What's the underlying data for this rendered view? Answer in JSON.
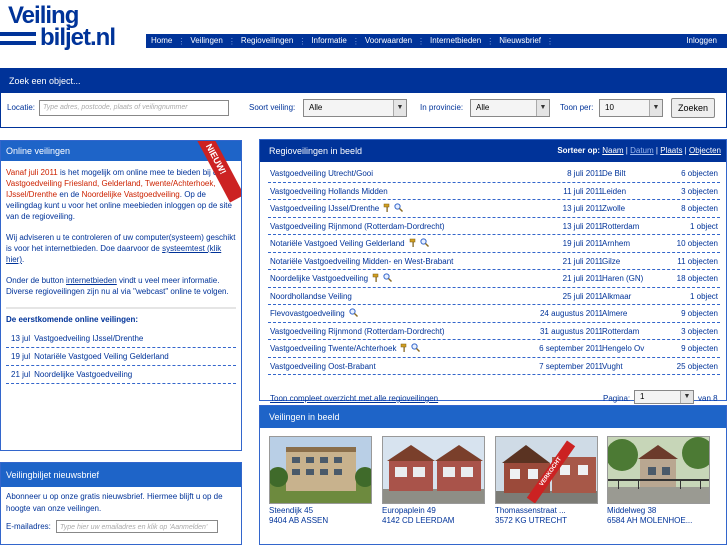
{
  "brand": {
    "line1": "Veiling",
    "line2": "biljet.nl"
  },
  "nav": {
    "items": [
      "Home",
      "Veilingen",
      "Regioveilingen",
      "Informatie",
      "Voorwaarden",
      "Internetbieden",
      "Nieuwsbrief"
    ],
    "login": "Inloggen"
  },
  "search": {
    "title": "Zoek een object...",
    "location_label": "Locatie:",
    "location_placeholder": "Type adres, postcode, plaats of veilingnummer",
    "type_label": "Soort veiling:",
    "type_value": "Alle",
    "province_label": "In provincie:",
    "province_value": "Alle",
    "show_label": "Toon per:",
    "show_value": "10",
    "button": "Zoeken"
  },
  "online": {
    "title": "Online veilingen",
    "ribbon": "NIEUW!",
    "p1_date": "Vanaf juli 2011",
    "p1_a": " is het mogelijk om online mee te bieden bij de ",
    "p1_b": "Vastgoedveiling Friesland, Gelderland, Twente/Achterhoek, IJssel/Drenthe",
    "p1_c": " en de ",
    "p1_d": "Noordelijke Vastgoedveiling",
    "p1_e": ". Op de veilingdag kunt u voor het online meebieden inloggen op de site van de regioveiling.",
    "p2_a": "Wij adviseren u te controleren of uw computer(systeem) geschikt is voor het internetbieden. Doe daarvoor de ",
    "p2_link": "systeemtest (klik hier)",
    "p2_b": ".",
    "p3_a": "Onder de button ",
    "p3_link": "internetbieden",
    "p3_b": " vindt u veel meer informatie. Diverse regioveilingen zijn nu al via \"webcast\" online te volgen.",
    "upcoming_title": "De eerstkomende online veilingen:",
    "upcoming": [
      {
        "date": "13 jul",
        "name": "Vastgoedveiling IJssel/Drenthe"
      },
      {
        "date": "19 jul",
        "name": "Notariële Vastgoed Veiling Gelderland"
      },
      {
        "date": "21 jul",
        "name": "Noordelijke Vastgoedveiling"
      }
    ]
  },
  "newsletter": {
    "title": "Veilingbiljet nieuwsbrief",
    "text": "Abonneer u op onze gratis nieuwsbrief. Hiermee blijft u op de hoogte van onze veilingen.",
    "email_label": "E-mailadres:",
    "email_placeholder": "Type hier uw emailadres en klik op 'Aanmelden'"
  },
  "regio": {
    "title": "Regioveilingen in beeld",
    "sort_label": "Sorteer op:",
    "sort_naam": "Naam",
    "sort_datum": "Datum",
    "sort_plaats": "Plaats",
    "sort_objecten": "Objecten",
    "rows": [
      {
        "name": "Vastgoedveiling Utrecht/Gooi",
        "date": "8 juli 2011",
        "place": "De Bilt",
        "objects": "6 objecten",
        "icons": []
      },
      {
        "name": "Vastgoedveiling Hollands Midden",
        "date": "11 juli 2011",
        "place": "Leiden",
        "objects": "3 objecten",
        "icons": []
      },
      {
        "name": "Vastgoedveiling IJssel/Drenthe",
        "date": "13 juli 2011",
        "place": "Zwolle",
        "objects": "8 objecten",
        "icons": [
          "hammer",
          "magnifier"
        ]
      },
      {
        "name": "Vastgoedveiling Rijnmond (Rotterdam-Dordrecht)",
        "date": "13 juli 2011",
        "place": "Rotterdam",
        "objects": "1 object",
        "icons": []
      },
      {
        "name": "Notariële Vastgoed Veiling Gelderland",
        "date": "19 juli 2011",
        "place": "Arnhem",
        "objects": "10 objecten",
        "icons": [
          "hammer",
          "magnifier"
        ]
      },
      {
        "name": "Notariële Vastgoedveiling Midden- en West-Brabant",
        "date": "21 juli 2011",
        "place": "Gilze",
        "objects": "11 objecten",
        "icons": []
      },
      {
        "name": "Noordelijke Vastgoedveiling",
        "date": "21 juli 2011",
        "place": "Haren (GN)",
        "objects": "18 objecten",
        "icons": [
          "hammer",
          "magnifier"
        ]
      },
      {
        "name": "Noordhollandse Veiling",
        "date": "25 juli 2011",
        "place": "Alkmaar",
        "objects": "1 object",
        "icons": []
      },
      {
        "name": "Flevovastgoedveiling",
        "date": "24 augustus 2011",
        "place": "Almere",
        "objects": "9 objecten",
        "icons": [
          "magnifier"
        ]
      },
      {
        "name": "Vastgoedveiling Rijnmond (Rotterdam-Dordrecht)",
        "date": "31 augustus 2011",
        "place": "Rotterdam",
        "objects": "3 objecten",
        "icons": []
      },
      {
        "name": "Vastgoedveiling Twente/Achterhoek",
        "date": "6 september 2011",
        "place": "Hengelo Ov",
        "objects": "9 objecten",
        "icons": [
          "hammer",
          "magnifier"
        ]
      },
      {
        "name": "Vastgoedveiling Oost-Brabant",
        "date": "7 september 2011",
        "place": "Vught",
        "objects": "25 objecten",
        "icons": []
      }
    ],
    "overview_link": "Toon compleet overzicht met alle regioveilingen",
    "page_label": "Pagina:",
    "page_value": "1",
    "page_of": "van 8",
    "next": ">"
  },
  "beeld": {
    "title": "Veilingen in beeld",
    "cards": [
      {
        "street": "Steendijk 45",
        "city": "9404 AB ASSEN",
        "badge": ""
      },
      {
        "street": "Europaplein 49",
        "city": "4142 CD LEERDAM",
        "badge": ""
      },
      {
        "street": "Thomassenstraat ...",
        "city": "3572 KG UTRECHT",
        "badge": "VERKOCHT"
      },
      {
        "street": "Middelweg 38",
        "city": "6584 AH MOLENHOE...",
        "badge": ""
      }
    ]
  },
  "colors": {
    "brand": "#003399",
    "header": "#1e64c8",
    "accent": "#cc2200"
  }
}
